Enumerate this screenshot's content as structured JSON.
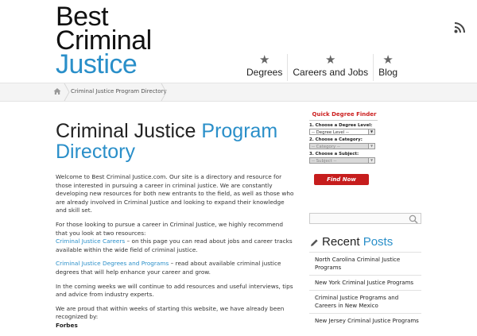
{
  "header": {
    "logo_line1": "Best",
    "logo_line2": "Criminal",
    "logo_line3": "Justice",
    "nav": [
      {
        "label": "Degrees"
      },
      {
        "label": "Careers and Jobs"
      },
      {
        "label": "Blog"
      }
    ]
  },
  "breadcrumb": {
    "current": "Criminal Justice Program Directory"
  },
  "main": {
    "title_dark": "Criminal Justice",
    "title_blue_1": "Program",
    "title_blue_2": "Directory",
    "p1": "Welcome to Best Criminal Justice.com. Our site is a directory and resource for those interested in pursuing a career in criminal justice. We are constantly developing new resources for both new entrants to the field, as well as those who are already involved in Criminal Justice and looking to expand their knowledge and skill set.",
    "p2": "For those looking to pursue a career in Criminal Justice, we highly recommend that you look at two resources:",
    "link1": "Criminal Justice Careers",
    "link1_rest": " – on this page you can read about jobs and career tracks available within the wide field of criminal justice.",
    "link2": "Criminal Justice Degrees and Programs",
    "link2_rest": " – read about available criminal justice degrees that will help enhance your career and grow.",
    "p3": "In the coming weeks we will continue to add resources and useful interviews, tips and advice from industry experts.",
    "p4": "We are proud that within weeks of starting this website, we have already been recognized by:",
    "p4_bold": "Forbes"
  },
  "finder": {
    "title": "Quick Degree Finder",
    "label1": "1. Choose a Degree Level:",
    "select1": "-- Degree Level --",
    "label2": "2. Choose a Category:",
    "select2": "-- Category --",
    "label3": "3. Choose a Subject:",
    "select3": "-- Subject --",
    "button": "Find Now"
  },
  "sidebar": {
    "recent_dark": "Recent",
    "recent_blue": "Posts",
    "recent_posts": [
      "North Carolina Criminal Justice Programs",
      "New York Criminal Justice Programs",
      "Criminal Justice Programs and Careers in New Mexico",
      "New Jersey Criminal Justice Programs"
    ]
  },
  "colors": {
    "accent": "#2a8fc9",
    "button_red": "#c61d1d"
  }
}
